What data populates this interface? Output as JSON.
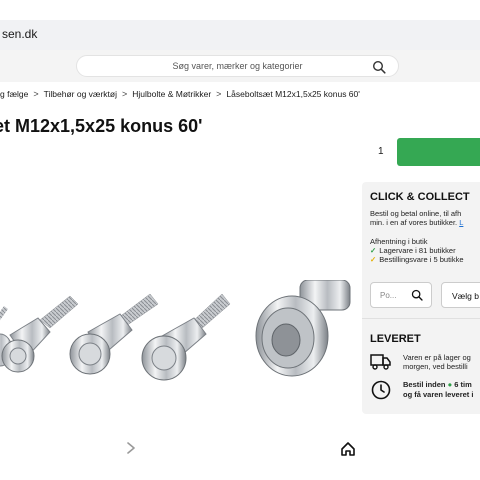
{
  "header": {
    "domain": "sen.dk"
  },
  "search": {
    "placeholder": "Søg varer, mærker og kategorier"
  },
  "breadcrumb": {
    "items": [
      "g fælge",
      "Tilbehør og værktøj",
      "Hjulbolte & Møtrikker",
      "Låseboltsæt M12x1,5x25 konus 60'"
    ]
  },
  "product": {
    "title": "et M12x1,5x25 konus 60'",
    "quantity": "1"
  },
  "click_collect": {
    "heading": "CLICK & COLLECT",
    "line1": "Bestil og betal online, til afh",
    "line2_prefix": "min. i en af vores butikker.",
    "line2_link": "L",
    "pickup_heading": "Afhentning i butik",
    "stock_green": "Lagervare i 81 butikker",
    "stock_yellow": "Bestillingsvare i 5 butikke",
    "postcode_placeholder": "Po...",
    "store_label": "Vælg b"
  },
  "delivery": {
    "heading": "LEVERET",
    "line1": "Varen er på lager og",
    "line2": "morgen, ved bestilli",
    "deadline_prefix": "Bestil inden",
    "deadline_value": "6 tim",
    "deadline_line2": "og få varen leveret i"
  },
  "colors": {
    "accent": "#35a853",
    "link": "#1d6fd1",
    "warning": "#e3b007"
  },
  "icons": [
    "search-icon",
    "truck-icon",
    "clock-icon",
    "chevron-right-icon",
    "home-icon"
  ]
}
